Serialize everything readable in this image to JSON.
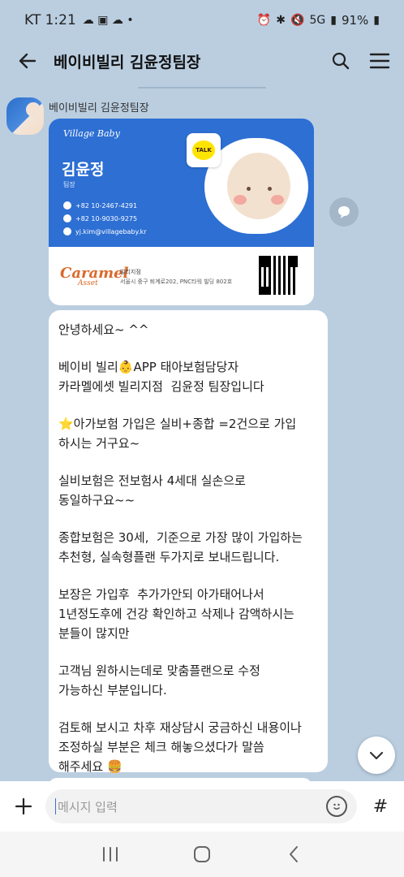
{
  "status_bar": {
    "carrier_time": "KT 1:21",
    "battery": "91%",
    "network": "5G"
  },
  "header": {
    "title": "베이비빌리 김윤정팀장"
  },
  "sender": {
    "name": "베이비빌리 김윤정팀장"
  },
  "card": {
    "brand": "Village Baby",
    "name": "김윤정",
    "role": "팀장",
    "phone1": "+82 10-2467-4291",
    "phone2": "+82 10-9030-9275",
    "email": "yj.kim@villagebaby.kr",
    "talk_label": "TALK",
    "logo": "Caramel",
    "logo_sub": "Asset",
    "branch": "빌리지점",
    "address": "서울시 중구 퇴계로202, PNC타워 빌딩 802호"
  },
  "message": {
    "lines": [
      "안녕하세요~ ^^",
      "",
      "베이비 빌리👶APP 태아보험담당자",
      "카라멜에셋 빌리지점  김윤정 팀장입니다",
      "",
      "⭐아가보험 가입은 실비+종합 =2건으로 가입",
      "하시는 거구요~",
      "",
      "실비보험은 전보험사 4세대 실손으로",
      "동일하구요~~",
      "",
      "종합보험은 30세,  기준으로 가장 많이 가입하는",
      "추천형, 실속형플랜 두가지로 보내드립니다.",
      "",
      "보장은 가입후  추가가안되 아가태어나서",
      "1년정도후에 건강 확인하고 삭제나 감액하시는",
      "분들이 많지만",
      "",
      "고객님 원하시는데로 맞춤플랜으로 수정",
      "가능하신 부분입니다.",
      "",
      "검토해 보시고 차후 재상담시 궁금하신 내용이나",
      "조정하실 부분은 체크 해놓으셨다가 말씀",
      "해주세요 🍔"
    ]
  },
  "input": {
    "placeholder": "메시지 입력"
  }
}
